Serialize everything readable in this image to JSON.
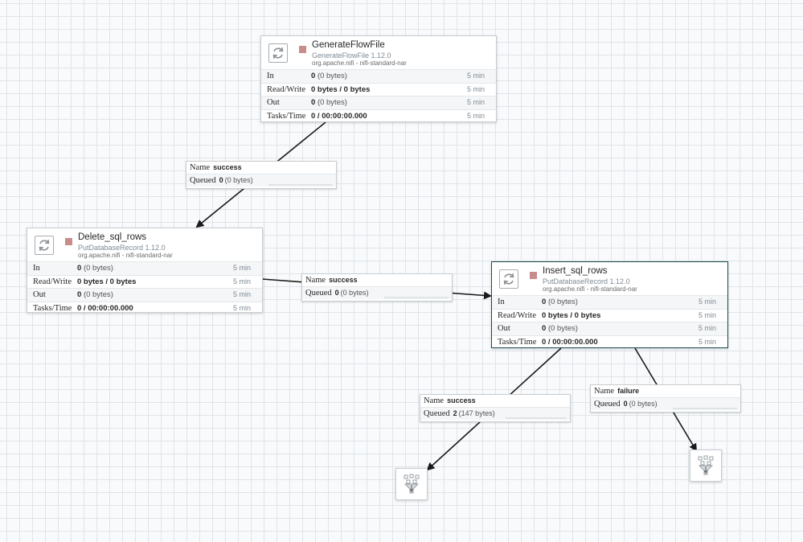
{
  "processors": {
    "generate": {
      "name": "GenerateFlowFile",
      "type": "GenerateFlowFile 1.12.0",
      "bundle": "org.apache.nifi - nifi-standard-nar",
      "icon": "processor-icon",
      "state": "stopped",
      "stats": [
        {
          "label": "In",
          "value": "0",
          "unit": "(0 bytes)",
          "window": "5 min"
        },
        {
          "label": "Read/Write",
          "value": "0 bytes / 0 bytes",
          "unit": "",
          "window": "5 min"
        },
        {
          "label": "Out",
          "value": "0",
          "unit": "(0 bytes)",
          "window": "5 min"
        },
        {
          "label": "Tasks/Time",
          "value": "0 / 00:00:00.000",
          "unit": "",
          "window": "5 min"
        }
      ]
    },
    "delete": {
      "name": "Delete_sql_rows",
      "type": "PutDatabaseRecord 1.12.0",
      "bundle": "org.apache.nifi - nifi-standard-nar",
      "icon": "processor-icon",
      "state": "stopped",
      "stats": [
        {
          "label": "In",
          "value": "0",
          "unit": "(0 bytes)",
          "window": "5 min"
        },
        {
          "label": "Read/Write",
          "value": "0 bytes / 0 bytes",
          "unit": "",
          "window": "5 min"
        },
        {
          "label": "Out",
          "value": "0",
          "unit": "(0 bytes)",
          "window": "5 min"
        },
        {
          "label": "Tasks/Time",
          "value": "0 / 00:00:00.000",
          "unit": "",
          "window": "5 min"
        }
      ]
    },
    "insert": {
      "name": "Insert_sql_rows",
      "type": "PutDatabaseRecord 1.12.0",
      "bundle": "org.apache.nifi - nifi-standard-nar",
      "icon": "processor-icon",
      "state": "stopped",
      "stats": [
        {
          "label": "In",
          "value": "0",
          "unit": "(0 bytes)",
          "window": "5 min"
        },
        {
          "label": "Read/Write",
          "value": "0 bytes / 0 bytes",
          "unit": "",
          "window": "5 min"
        },
        {
          "label": "Out",
          "value": "0",
          "unit": "(0 bytes)",
          "window": "5 min"
        },
        {
          "label": "Tasks/Time",
          "value": "0 / 00:00:00.000",
          "unit": "",
          "window": "5 min"
        }
      ]
    }
  },
  "connections": {
    "gen_to_delete": {
      "name_key": "Name",
      "name": "success",
      "queued_key": "Queued",
      "count": "0",
      "size": "(0 bytes)"
    },
    "delete_to_insert": {
      "name_key": "Name",
      "name": "success",
      "queued_key": "Queued",
      "count": "0",
      "size": "(0 bytes)"
    },
    "insert_success": {
      "name_key": "Name",
      "name": "success",
      "queued_key": "Queued",
      "count": "2",
      "size": "(147 bytes)"
    },
    "insert_failure": {
      "name_key": "Name",
      "name": "failure",
      "queued_key": "Queued",
      "count": "0",
      "size": "(0 bytes)"
    }
  },
  "funnels": [
    {
      "icon": "funnel-icon"
    },
    {
      "icon": "funnel-icon"
    }
  ],
  "colors": {
    "stopped": "#c98c8c",
    "selected_border": "#1e4a4f",
    "grid": "#dfe5ea",
    "connection_line": "#1a1a1a"
  }
}
